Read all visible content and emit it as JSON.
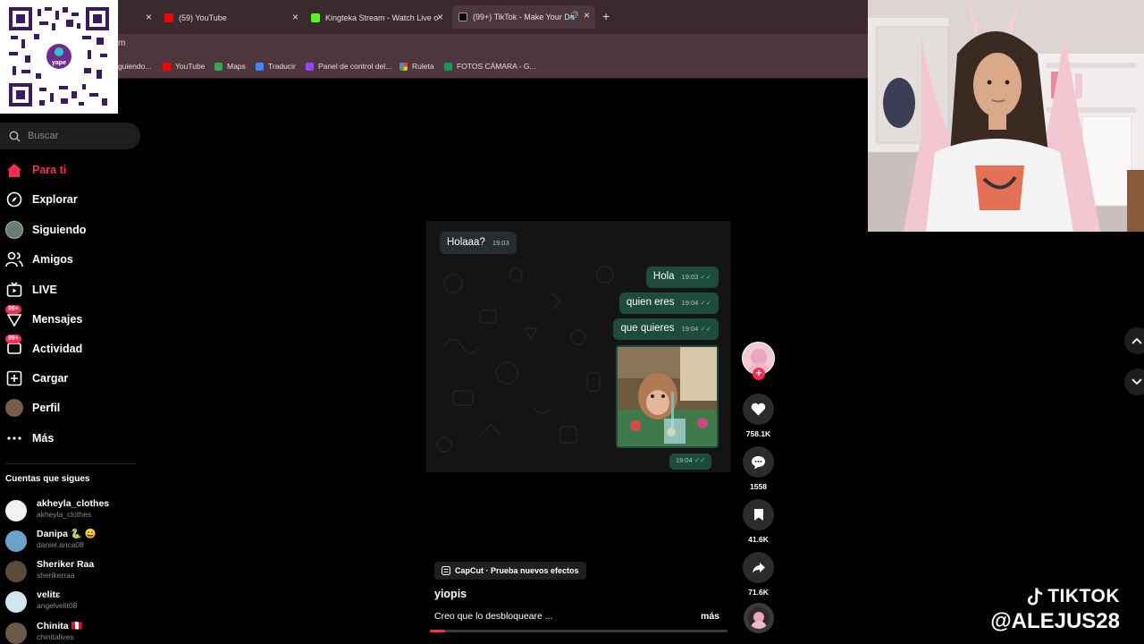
{
  "browser": {
    "tabs": [
      {
        "title": "(59) YouTube",
        "color": "#ff0000"
      },
      {
        "title": "Kingteka Stream - Watch Live o",
        "color": "#53fc18"
      },
      {
        "title": "(99+) TikTok - Make Your Da",
        "color": "#000000"
      }
    ],
    "address_fragment": "m",
    "bookmarks": [
      {
        "label": "guiendo...",
        "color": "#cccccc"
      },
      {
        "label": "YouTube",
        "color": "#ff0000"
      },
      {
        "label": "Maps",
        "color": "#34a853"
      },
      {
        "label": "Traducir",
        "color": "#4285f4"
      },
      {
        "label": "Panel de control del...",
        "color": "#9146ff"
      },
      {
        "label": "Ruleta",
        "color": "#fbbc05"
      },
      {
        "label": "FOTOS CÁMARA - G...",
        "color": "#0f9d58"
      }
    ]
  },
  "qr": {
    "brand": "yape"
  },
  "search": {
    "placeholder": "Buscar"
  },
  "nav": [
    {
      "label": "Para ti",
      "icon": "home-icon"
    },
    {
      "label": "Explorar",
      "icon": "compass-icon"
    },
    {
      "label": "Siguiendo",
      "icon": "following-avatar-icon"
    },
    {
      "label": "Amigos",
      "icon": "friends-icon"
    },
    {
      "label": "LIVE",
      "icon": "live-icon"
    },
    {
      "label": "Mensajes",
      "icon": "messages-icon",
      "badge": "99+"
    },
    {
      "label": "Actividad",
      "icon": "activity-icon",
      "badge": "99+"
    },
    {
      "label": "Cargar",
      "icon": "upload-icon"
    },
    {
      "label": "Perfil",
      "icon": "profile-avatar-icon"
    },
    {
      "label": "Más",
      "icon": "more-icon"
    }
  ],
  "following": {
    "title": "Cuentas que sigues",
    "accounts": [
      {
        "name": "akheyla_clothes",
        "handle": "akheyla_clothes",
        "color": "#f2f2f2"
      },
      {
        "name": "Danipa 🐍 😀",
        "handle": "daniel.arica08",
        "color": "#6aa3c8"
      },
      {
        "name": "Sheriker Raa",
        "handle": "sherikerraa",
        "color": "#5a4a3a"
      },
      {
        "name": "velitɛ",
        "handle": "angelvelit08",
        "color": "#cfe8ee"
      },
      {
        "name": "Chinita 🇵🇪",
        "handle": "chinitalives",
        "color": "#6a5a4a"
      }
    ]
  },
  "chat": {
    "incoming": {
      "text": "Holaaa?",
      "time": "19:03"
    },
    "outgoing": [
      {
        "text": "Hola",
        "time": "19:03"
      },
      {
        "text": "quien eres",
        "time": "19:04"
      },
      {
        "text": "que quieres",
        "time": "19:04"
      }
    ],
    "image_time": "19:04",
    "check": "✓✓"
  },
  "post": {
    "effect": "CapCut · Prueba nuevos efectos",
    "author": "yiopis",
    "caption": "Creo que lo desbloqueare ...",
    "more": "más",
    "progress": 0.05
  },
  "actions": {
    "likes": "758.1K",
    "comments": "1558",
    "saves": "41.6K",
    "shares": "71.6K"
  },
  "overlay": {
    "line1": "TIKTOK",
    "line2": "@ALEJUS28"
  }
}
